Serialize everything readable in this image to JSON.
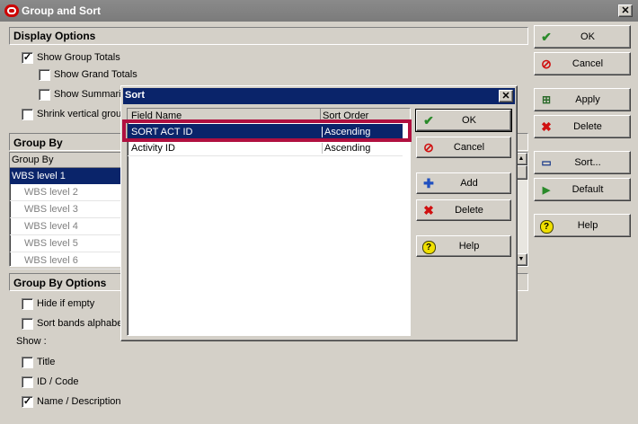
{
  "window": {
    "title": "Group and Sort",
    "close": "✕"
  },
  "display_options": {
    "header": "Display Options",
    "show_group_totals": {
      "label": "Show Group Totals",
      "checked": true
    },
    "show_grand_totals": {
      "label": "Show Grand Totals",
      "checked": false
    },
    "show_summaries": {
      "label": "Show Summari",
      "checked": false
    },
    "shrink_vertical": {
      "label": "Shrink vertical grou",
      "checked": false
    }
  },
  "group_by": {
    "header": "Group By",
    "column": "Group By",
    "rows": [
      "WBS level 1",
      "WBS level 2",
      "WBS level 3",
      "WBS level 4",
      "WBS level 5",
      "WBS level 6"
    ]
  },
  "group_by_options": {
    "header": "Group By Options",
    "hide_if_empty": {
      "label": "Hide if empty",
      "checked": false
    },
    "sort_bands": {
      "label": "Sort bands alphabe",
      "checked": false
    },
    "show_label": "Show :",
    "title": {
      "label": "Title",
      "checked": false
    },
    "id_code": {
      "label": "ID / Code",
      "checked": false
    },
    "name_desc": {
      "label": "Name / Description",
      "checked": true
    }
  },
  "main_buttons": {
    "ok": "OK",
    "cancel": "Cancel",
    "apply": "Apply",
    "delete": "Delete",
    "sort": "Sort...",
    "default": "Default",
    "help": "Help"
  },
  "sort_dialog": {
    "title": "Sort",
    "close": "✕",
    "columns": {
      "field": "Field Name",
      "order": "Sort Order"
    },
    "rows": [
      {
        "field": "SORT ACT ID",
        "order": "Ascending",
        "selected": true
      },
      {
        "field": "Activity ID",
        "order": "Ascending",
        "selected": false
      }
    ],
    "buttons": {
      "ok": "OK",
      "cancel": "Cancel",
      "add": "Add",
      "delete": "Delete",
      "help": "Help"
    }
  },
  "colors": {
    "selection": "#0a246a",
    "highlight_box": "#b01040",
    "ok_green": "#2a8a2a",
    "cancel_red": "#d01010"
  }
}
